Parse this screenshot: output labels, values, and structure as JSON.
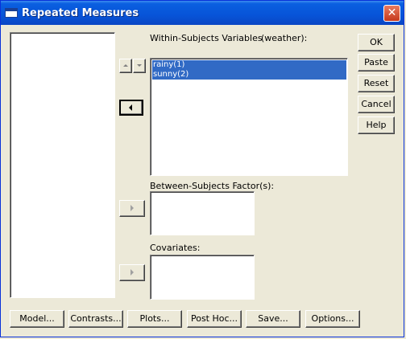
{
  "window": {
    "title": "Repeated Measures",
    "close_glyph": "✕"
  },
  "within": {
    "label": "Within-Subjects Variables",
    "factor": "(weather):",
    "items": [
      "rainy(1)",
      "sunny(2)"
    ]
  },
  "between": {
    "label": "Between-Subjects Factor(s):"
  },
  "covariates": {
    "label": "Covariates:"
  },
  "side_buttons": {
    "ok": "OK",
    "paste": "Paste",
    "reset": "Reset",
    "cancel": "Cancel",
    "help": "Help"
  },
  "bottom_buttons": {
    "model": "Model...",
    "contrasts": "Contrasts...",
    "plots": "Plots...",
    "post_hoc": "Post Hoc...",
    "save": "Save...",
    "options": "Options..."
  },
  "icons": {
    "move_up": "chevron-up-icon",
    "move_down": "chevron-down-icon",
    "move_left": "arrow-left-icon",
    "move_right": "arrow-right-icon"
  },
  "colors": {
    "titlebar": "#0754d8",
    "selection": "#316ac5",
    "dialog_bg": "#ece9d8"
  }
}
